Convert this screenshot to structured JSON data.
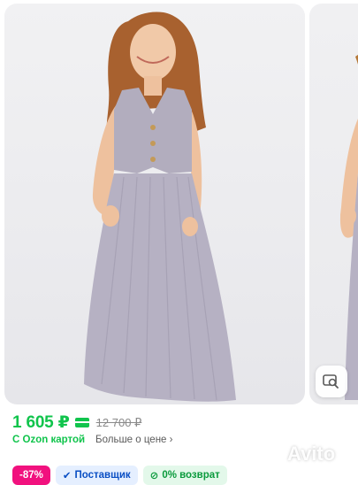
{
  "product": {
    "price_current": "1 605 ₽",
    "price_old": "12 700 ₽",
    "ozon_card_label": "С Ozon картой",
    "more_price_label": "Больше о цене"
  },
  "badges": {
    "discount": "-87%",
    "supplier": "Поставщик",
    "return": "0% возврат"
  },
  "watermark": {
    "text": "Avito"
  },
  "colors": {
    "accent_green": "#10c44c",
    "discount_pink": "#f1117e",
    "supplier_blue": "#0a4fc4"
  }
}
